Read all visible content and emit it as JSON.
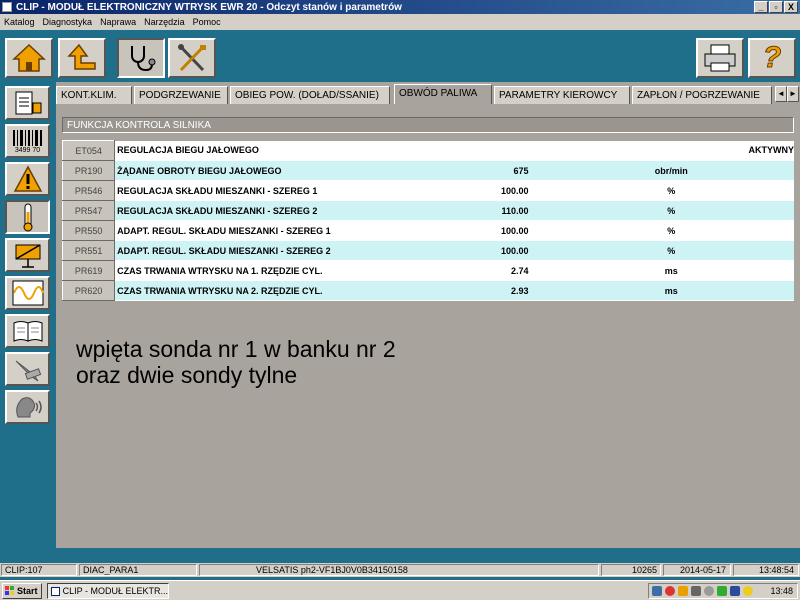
{
  "window": {
    "title": "CLIP - MODUŁ ELEKTRONICZNY WTRYSK EWR 20 - Odczyt stanów i parametrów",
    "controls": [
      "_",
      "▫",
      "X"
    ]
  },
  "menu": [
    "Katalog",
    "Diagnostyka",
    "Naprawa",
    "Narzędzia",
    "Pomoc"
  ],
  "toolbar": {
    "left_icons": [
      "home-icon",
      "back-arrow-icon",
      "stethoscope-icon",
      "tools-icon"
    ],
    "right_icons": [
      "printer-icon",
      "help-icon"
    ],
    "help_label": "?"
  },
  "sidebar_icons": [
    "document-icon",
    "barcode-icon",
    "warning-icon",
    "thermometer-icon",
    "actuator-icon",
    "oscilloscope-icon",
    "book-icon",
    "tools-wrench-icon",
    "speech-icon"
  ],
  "barcode_text": "3499 70",
  "tabs": [
    {
      "label": "KONT.KLIM.",
      "active": false
    },
    {
      "label": "PODGRZEWANIE",
      "active": false
    },
    {
      "label": "OBIEG POW. (DOŁAD/SSANIE)",
      "active": false
    },
    {
      "label": "OBWÓD PALIWA",
      "active": true
    },
    {
      "label": "PARAMETRY KIEROWCY",
      "active": false
    },
    {
      "label": "ZAPŁON / POGRZEWANIE",
      "active": false
    }
  ],
  "tab_scroll": {
    "left": "◄",
    "right": "►"
  },
  "section_title": "FUNKCJA KONTROLA SILNIKA",
  "rows": [
    {
      "code": "ET054",
      "name": "REGULACJA BIEGU JAŁOWEGO",
      "value": "AKTYWNY",
      "unit": ""
    },
    {
      "code": "PR190",
      "name": "ŻĄDANE OBROTY BIEGU JAŁOWEGO",
      "value": "675",
      "unit": "obr/min"
    },
    {
      "code": "PR546",
      "name": "REGULACJA SKŁADU MIESZANKI - SZEREG 1",
      "value": "100.00",
      "unit": "%"
    },
    {
      "code": "PR547",
      "name": "REGULACJA SKŁADU MIESZANKI - SZEREG 2",
      "value": "110.00",
      "unit": "%"
    },
    {
      "code": "PR550",
      "name": "ADAPT. REGUL. SKŁADU MIESZANKI - SZEREG 1",
      "value": "100.00",
      "unit": "%"
    },
    {
      "code": "PR551",
      "name": "ADAPT. REGUL. SKŁADU MIESZANKI - SZEREG 2",
      "value": "100.00",
      "unit": "%"
    },
    {
      "code": "PR619",
      "name": "CZAS TRWANIA WTRYSKU NA 1. RZĘDZIE CYL.",
      "value": "2.74",
      "unit": "ms"
    },
    {
      "code": "PR620",
      "name": "CZAS TRWANIA WTRYSKU NA 2. RZĘDZIE CYL.",
      "value": "2.93",
      "unit": "ms"
    }
  ],
  "note": "wpięta sonda nr 1 w banku nr 2\noraz dwie sondy tylne",
  "statusbar": {
    "clip": "CLIP:107",
    "diag": "DIAC_PARA1",
    "vehicle": "VELSATIS ph2-VF1BJ0V0B34150158",
    "code": "10265",
    "date": "2014-05-17",
    "time": "13:48:54"
  },
  "taskbar": {
    "start_label": "Start",
    "task_label": "CLIP - MODUŁ ELEKTR...",
    "clock": "13:48"
  },
  "colors": {
    "accent": "#1f6f8b",
    "row_cyan": "#cdf3f5",
    "panel": "#a8a49d"
  }
}
